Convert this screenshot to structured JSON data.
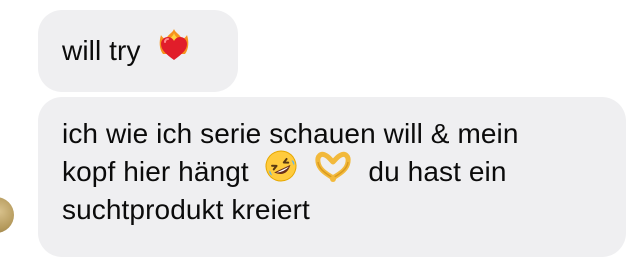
{
  "messages": [
    {
      "text": "will try",
      "trailing_emoji": "heart-on-fire-icon"
    },
    {
      "line1": "ich wie ich serie schauen will & mein",
      "line2_before": "kopf hier hängt",
      "line2_emojis": [
        "rolling-on-floor-laughing-icon",
        "heart-hands-icon"
      ],
      "line2_after": "du hast ein",
      "line3": "suchtprodukt kreiert"
    }
  ],
  "colors": {
    "bubble": "#efeff1",
    "text": "#0b0b0b",
    "avatar": "#b59a5c"
  }
}
